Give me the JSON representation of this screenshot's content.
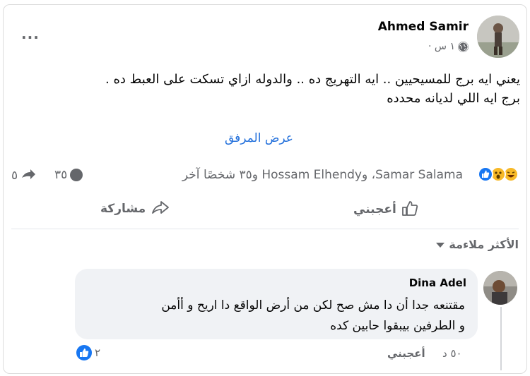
{
  "post": {
    "author": "Ahmed Samir",
    "time": "١ س ·",
    "menu_label": "...",
    "text_line1": "يعني ايه برج للمسيحيين .. ايه التهريج ده ..  والدوله ازاي تسكت على العبط ده .",
    "text_line2": "برج ايه اللي لديانه محدده",
    "see_attachment": "عرض المرفق",
    "reactions_text": "Samar Salama، وHossam Elhendy و٣٥ شخصًا آخر",
    "comments_count": "٣٥",
    "shares_count": "٥",
    "like_label": "أعجبني",
    "share_label": "مشاركة"
  },
  "comments_section": {
    "sort_label": "الأكثر ملاءمة"
  },
  "comment": {
    "author": "Dina Adel",
    "line1": "مقتنعه جدا أن دا مش صح لكن من أرض الواقع دا اريح و أأمن",
    "line2": "و الطرفين بيبقوا حابين كده",
    "time": "٥٠ د",
    "like_label": "أعجبني",
    "reaction_count": "٢"
  },
  "colors": {
    "like_blue": "#1877f2",
    "haha_yellow": "#f7b928",
    "link_blue": "#216fdb",
    "meta_gray": "#65676b"
  }
}
